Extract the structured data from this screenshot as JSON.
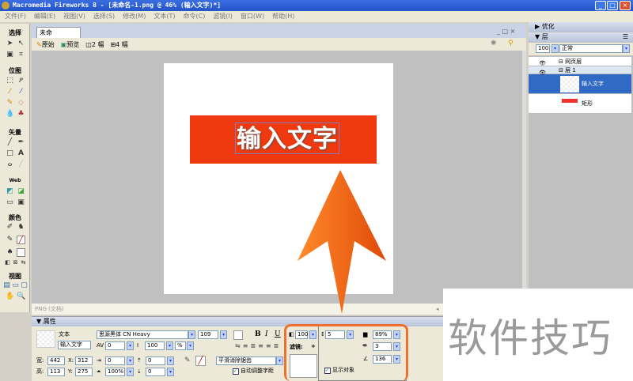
{
  "title": "Macromedia Fireworks 8 - [未命名-1.png @ 46% (输入文字)*]",
  "menu": [
    "文件(F)",
    "编辑(E)",
    "视图(V)",
    "选择(S)",
    "修改(M)",
    "文本(T)",
    "命令(C)",
    "滤镜(I)",
    "窗口(W)",
    "帮助(H)"
  ],
  "toolbox": {
    "sections": [
      "选择",
      "位图",
      "矢量",
      "Web",
      "颜色",
      "视图"
    ]
  },
  "document": {
    "tab": "未命名-1.png*",
    "views": [
      "原始",
      "预览",
      "2 幅",
      "4 幅"
    ],
    "canvas_text": "输入文字",
    "status": "PNG (文档)",
    "frame": "1"
  },
  "properties": {
    "header": "属性",
    "type": "文本",
    "name": "输入文字",
    "width_label": "宽:",
    "width": "442",
    "height_label": "高:",
    "height": "113",
    "x_label": "X:",
    "x": "312",
    "y_label": "Y:",
    "y": "275",
    "font": "思源黑体 CN Heavy",
    "size": "109",
    "kerning": "0",
    "leading": "100",
    "leading_unit": "%",
    "indent": "0",
    "space_before": "0",
    "space_after": "0",
    "scale": "100%",
    "baseline": "0",
    "antialias": "平滑消除锯齿",
    "auto_kern": "自动调整字距",
    "opacity": "100",
    "filters_label": "滤镜:",
    "stroke": "5",
    "shadow_opacity": "89%",
    "softness": "3",
    "angle": "136",
    "show_object": "显示对象"
  },
  "right_panel": {
    "optimize": "优化",
    "layers": "层",
    "opacity": "100",
    "blend": "正常",
    "layers_list": [
      {
        "name": "网页层"
      },
      {
        "name": "层 1"
      },
      {
        "name": "输入文字",
        "selected": true
      },
      {
        "name": "矩形"
      }
    ]
  },
  "watermark": "软件技巧",
  "colors": {
    "accent": "#f0390e",
    "arrow": "#f06a1a",
    "selection": "#316ac5"
  }
}
